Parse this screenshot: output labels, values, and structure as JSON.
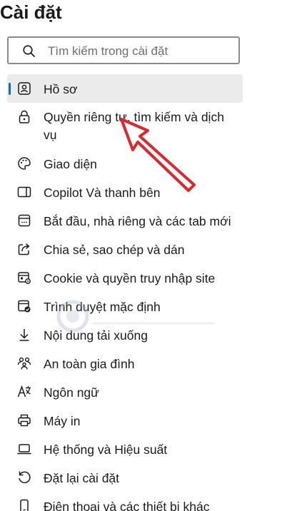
{
  "page": {
    "title": "Cài đặt"
  },
  "search": {
    "placeholder": "Tìm kiếm trong cài đặt",
    "icon": "search-icon"
  },
  "nav": {
    "items": [
      {
        "label": "Hồ sơ",
        "icon": "profile-icon",
        "selected": true
      },
      {
        "label": "Quyền riêng tư, tìm kiếm và dịch vụ",
        "icon": "lock-icon",
        "selected": false
      },
      {
        "label": "Giao diện",
        "icon": "palette-icon",
        "selected": false
      },
      {
        "label": "Copilot Và thanh bên",
        "icon": "sidebar-icon",
        "selected": false
      },
      {
        "label": "Bắt đầu, nhà riêng và các tab mới",
        "icon": "new-tab-icon",
        "selected": false
      },
      {
        "label": "Chia sẻ, sao chép và dán",
        "icon": "share-icon",
        "selected": false
      },
      {
        "label": "Cookie và quyền truy nhập site",
        "icon": "cookie-permissions-icon",
        "selected": false
      },
      {
        "label": "Trình duyệt mặc định",
        "icon": "default-browser-icon",
        "selected": false
      },
      {
        "label": "Nội dung tải xuống",
        "icon": "download-icon",
        "selected": false
      },
      {
        "label": "An toàn gia đình",
        "icon": "family-icon",
        "selected": false
      },
      {
        "label": "Ngôn ngữ",
        "icon": "language-icon",
        "selected": false
      },
      {
        "label": "Máy in",
        "icon": "printer-icon",
        "selected": false
      },
      {
        "label": "Hệ thống và Hiệu suất",
        "icon": "laptop-icon",
        "selected": false
      },
      {
        "label": "Đặt lại cài đặt",
        "icon": "reset-icon",
        "selected": false
      },
      {
        "label": "Điện thoại và các thiết bị khác",
        "icon": "phone-icon",
        "selected": false
      }
    ]
  },
  "annotation": {
    "arrow_color": "#e0262d"
  },
  "colors": {
    "accent": "#0f6cbd",
    "selected_bg": "#ebebeb",
    "text": "#1b1b1b"
  }
}
